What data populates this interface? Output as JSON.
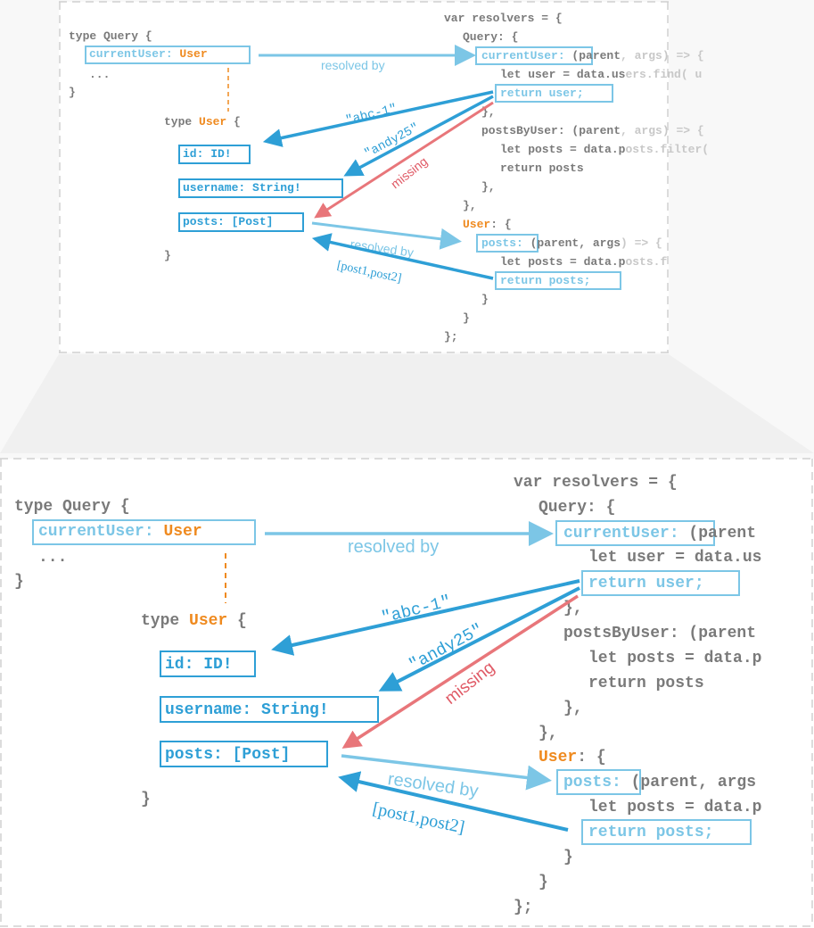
{
  "schema": {
    "type_query_open": "type Query {",
    "current_user_field": "currentUser: ",
    "current_user_type": "User",
    "ellipsis": "...",
    "close_brace": "}",
    "type_user_prefix": "type ",
    "type_user_name": "User",
    "type_user_brace": " {",
    "fields": [
      "id: ID!",
      "username: String!",
      "posts: [Post]"
    ]
  },
  "resolvers": {
    "line_var": "var resolvers = {",
    "line_query": "Query: {",
    "current_user_key": "currentUser:",
    "current_user_sig_visible": " (parent",
    "current_user_sig_faded": ", args) => {",
    "let_user_visible": "let user = data.us",
    "let_user_faded": "ers.find( u",
    "return_user": "return user;",
    "close_partial": "},",
    "posts_by_user_visible": "postsByUser: (parent",
    "posts_by_user_faded": ", args) => {",
    "let_posts_filter_visible": "let posts = data.p",
    "let_posts_filter_faded": "osts.filter(",
    "return_posts_plain": "return posts",
    "close_inner": "},",
    "close_query": "},",
    "user_key": "User",
    "user_brace": ": {",
    "posts_key": "posts:",
    "posts_sig_visible": " (parent, args",
    "posts_sig_faded": ") => {",
    "let_posts_visible": "let posts = data.p",
    "let_posts_faded": "osts.f",
    "return_posts": "return posts;",
    "close_1": "}",
    "close_2": "}",
    "close_3": "};"
  },
  "annotations": {
    "resolved_by_1": "resolved by",
    "resolved_by_2": "resolved by",
    "id_value": "\"abc-1\"",
    "username_value": "\"andy25\"",
    "missing": "missing",
    "posts_value": "[post1,post2]"
  },
  "colors": {
    "light_blue": "#7cc6e6",
    "dark_blue": "#2e9fd6",
    "orange": "#ef8a1f",
    "red": "#e8767a",
    "code_gray": "#7a7a7a",
    "faded_gray": "#c8c8c8"
  }
}
